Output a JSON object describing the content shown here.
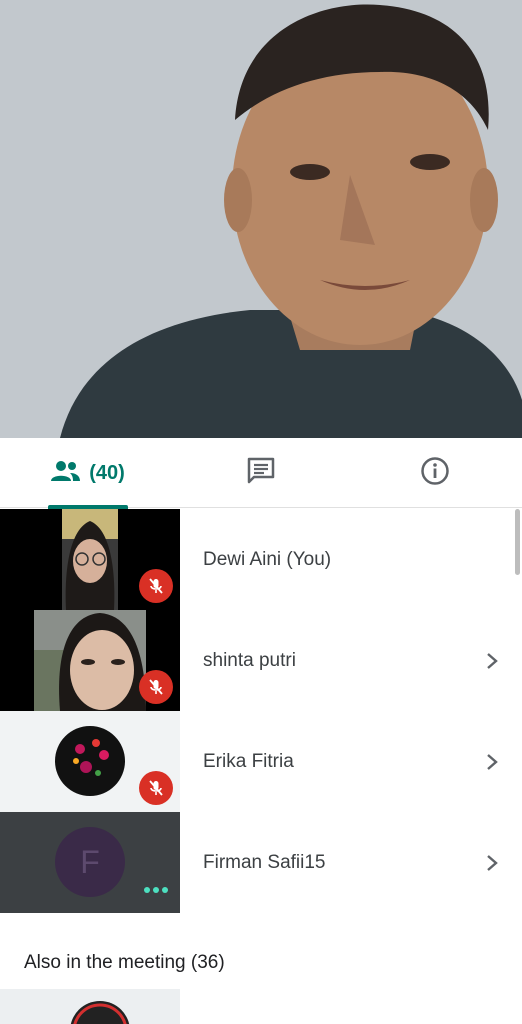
{
  "tabs": {
    "people_count": "(40)",
    "people_icon": "people-icon",
    "chat_icon": "chat-icon",
    "info_icon": "info-icon",
    "accent_color": "#00796b"
  },
  "participants": [
    {
      "name": "Dewi Aini (You)",
      "muted": true
    },
    {
      "name": "shinta putri",
      "muted": true
    },
    {
      "name": "Erika Fitria",
      "muted": true
    },
    {
      "name": "Firman Safii15",
      "initial": "F"
    }
  ],
  "also_in_meeting": {
    "label": "Also in the meeting (36)"
  }
}
